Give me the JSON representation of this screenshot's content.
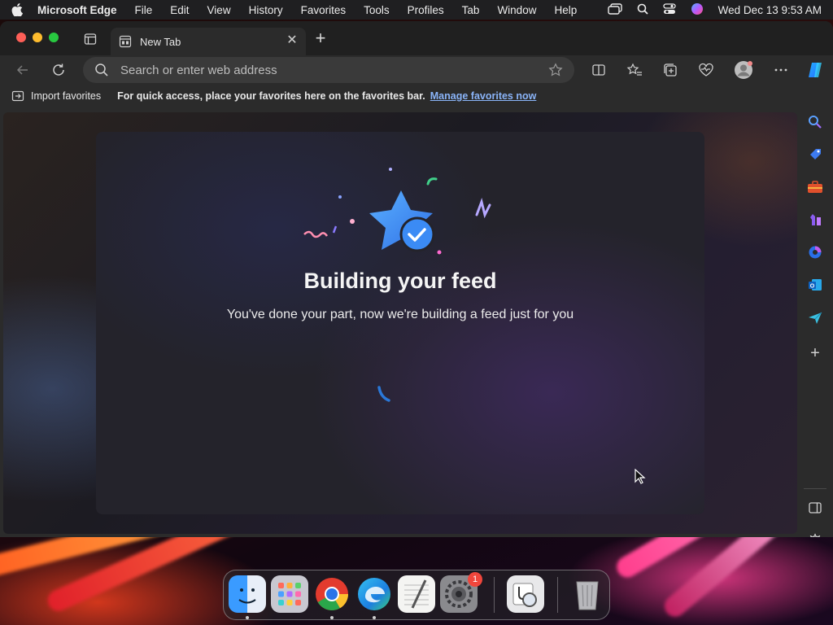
{
  "menubar": {
    "app_name": "Microsoft Edge",
    "items": [
      "File",
      "Edit",
      "View",
      "History",
      "Favorites",
      "Tools",
      "Profiles",
      "Tab",
      "Window",
      "Help"
    ],
    "clock": "Wed Dec 13  9:53 AM"
  },
  "tab": {
    "title": "New Tab"
  },
  "addressbar": {
    "placeholder": "Search or enter web address"
  },
  "favbar": {
    "import_label": "Import favorites",
    "hint": "For quick access, place your favorites here on the favorites bar.",
    "manage_link": "Manage favorites now"
  },
  "feed": {
    "title": "Building your feed",
    "subtitle": "You've done your part, now we're building a feed just for you"
  },
  "dock": {
    "apps": [
      "finder",
      "launchpad",
      "chrome",
      "edge",
      "textedit",
      "system-settings",
      "preview",
      "trash"
    ],
    "settings_badge": "1"
  },
  "colors": {
    "accent": "#8ab4f8",
    "star": "#3b82f6"
  }
}
